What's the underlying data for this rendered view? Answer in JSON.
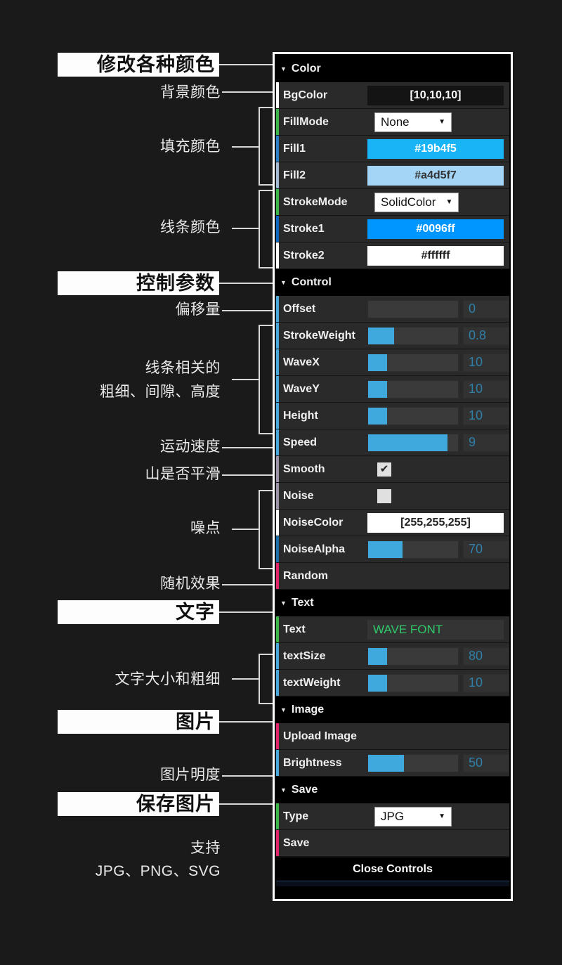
{
  "annotations": {
    "headings": [
      {
        "text": "修改各种颜色",
        "name": "annotation-heading-colors"
      },
      {
        "text": "控制参数",
        "name": "annotation-heading-control"
      },
      {
        "text": "文字",
        "name": "annotation-heading-text"
      },
      {
        "text": "图片",
        "name": "annotation-heading-image"
      },
      {
        "text": "保存图片",
        "name": "annotation-heading-save"
      }
    ],
    "labels": [
      {
        "text": "背景颜色",
        "name": "annotation-label-bgcolor"
      },
      {
        "text": "填充颜色",
        "name": "annotation-label-fillcolor"
      },
      {
        "text": "线条颜色",
        "name": "annotation-label-strokecolor"
      },
      {
        "text": "偏移量",
        "name": "annotation-label-offset"
      },
      {
        "text": "线条相关的\n粗细、间隙、高度",
        "name": "annotation-label-linerelated"
      },
      {
        "text": "运动速度",
        "name": "annotation-label-speed"
      },
      {
        "text": "山是否平滑",
        "name": "annotation-label-smooth"
      },
      {
        "text": "噪点",
        "name": "annotation-label-noise"
      },
      {
        "text": "随机效果",
        "name": "annotation-label-random"
      },
      {
        "text": "文字大小和粗细",
        "name": "annotation-label-textsize"
      },
      {
        "text": "图片明度",
        "name": "annotation-label-brightness"
      },
      {
        "text": "支持\nJPG、PNG、SVG",
        "name": "annotation-label-formats"
      }
    ]
  },
  "panel": {
    "close_label": "Close Controls",
    "sections": [
      {
        "title": "Color",
        "rows": [
          {
            "label": "BgColor",
            "type": "colorvalue",
            "value": "[10,10,10]",
            "bg": "#141414",
            "fg": "#ffffff",
            "accent": "#ffffff"
          },
          {
            "label": "FillMode",
            "type": "select",
            "value": "None",
            "accent": "#3bb54a"
          },
          {
            "label": "Fill1",
            "type": "colorvalue",
            "value": "#19b4f5",
            "bg": "#19b4f5",
            "fg": "#ffffff",
            "accent": "#2b7fc4"
          },
          {
            "label": "Fill2",
            "type": "colorvalue",
            "value": "#a4d5f7",
            "bg": "#a4d5f7",
            "fg": "#333333",
            "accent": "#a4b8d8"
          },
          {
            "label": "StrokeMode",
            "type": "select",
            "value": "SolidColor",
            "accent": "#3bb54a"
          },
          {
            "label": "Stroke1",
            "type": "colorvalue",
            "value": "#0096ff",
            "bg": "#0096ff",
            "fg": "#ffffff",
            "accent": "#0d66c2"
          },
          {
            "label": "Stroke2",
            "type": "colorvalue",
            "value": "#ffffff",
            "bg": "#ffffff",
            "fg": "#222222",
            "accent": "#ffffff"
          }
        ]
      },
      {
        "title": "Control",
        "rows": [
          {
            "label": "Offset",
            "type": "slider",
            "value": "0",
            "pct": 0,
            "accent": "#4aa8d8"
          },
          {
            "label": "StrokeWeight",
            "type": "slider",
            "value": "0.8",
            "pct": 29,
            "accent": "#4aa8d8"
          },
          {
            "label": "WaveX",
            "type": "slider",
            "value": "10",
            "pct": 21,
            "accent": "#4aa8d8"
          },
          {
            "label": "WaveY",
            "type": "slider",
            "value": "10",
            "pct": 21,
            "accent": "#4aa8d8"
          },
          {
            "label": "Height",
            "type": "slider",
            "value": "10",
            "pct": 21,
            "accent": "#4aa8d8"
          },
          {
            "label": "Speed",
            "type": "slider",
            "value": "9",
            "pct": 88,
            "accent": "#4aa8d8"
          },
          {
            "label": "Smooth",
            "type": "checkbox",
            "checked": true,
            "accent": "#9d93a8"
          },
          {
            "label": "Noise",
            "type": "checkbox",
            "checked": false,
            "accent": "#9d93a8"
          },
          {
            "label": "NoiseColor",
            "type": "colorvalue",
            "value": "[255,255,255]",
            "bg": "#ffffff",
            "fg": "#222222",
            "accent": "#ffffff"
          },
          {
            "label": "NoiseAlpha",
            "type": "slider",
            "value": "70",
            "pct": 38,
            "accent": "#1d6fa8"
          },
          {
            "label": "Random",
            "type": "action",
            "accent": "#e0266b"
          }
        ]
      },
      {
        "title": "Text",
        "rows": [
          {
            "label": "Text",
            "type": "textinput",
            "value": "WAVE FONT",
            "fg": "#2fc96a",
            "accent": "#3bb54a"
          },
          {
            "label": "textSize",
            "type": "slider",
            "value": "80",
            "pct": 21,
            "accent": "#4aa8d8"
          },
          {
            "label": "textWeight",
            "type": "slider",
            "value": "10",
            "pct": 21,
            "accent": "#4aa8d8"
          }
        ]
      },
      {
        "title": "Image",
        "rows": [
          {
            "label": "Upload Image",
            "type": "action",
            "accent": "#e0266b"
          },
          {
            "label": "Brightness",
            "type": "slider",
            "value": "50",
            "pct": 40,
            "accent": "#4aa8d8"
          }
        ]
      },
      {
        "title": "Save",
        "rows": [
          {
            "label": "Type",
            "type": "select",
            "value": "JPG",
            "accent": "#3bb54a"
          },
          {
            "label": "Save",
            "type": "action",
            "accent": "#e0266b"
          }
        ]
      }
    ]
  }
}
